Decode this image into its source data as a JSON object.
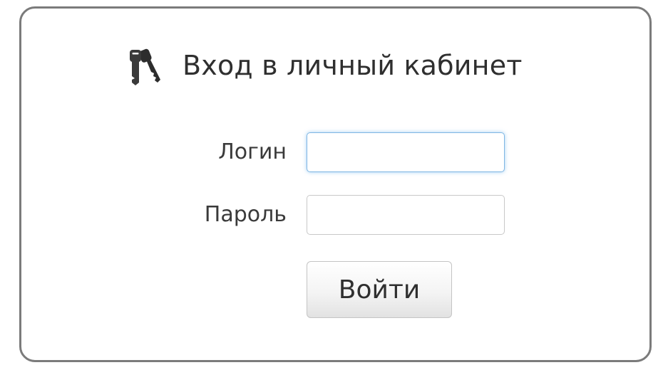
{
  "login_form": {
    "title": "Вход в личный кабинет",
    "icon": "keys-icon",
    "login": {
      "label": "Логин",
      "value": "",
      "focused": true
    },
    "password": {
      "label": "Пароль",
      "value": ""
    },
    "submit_label": "Войти"
  },
  "colors": {
    "panel_border": "#7b7b7b",
    "focus_ring": "#7fb6e3",
    "text": "#2f2f2f"
  }
}
